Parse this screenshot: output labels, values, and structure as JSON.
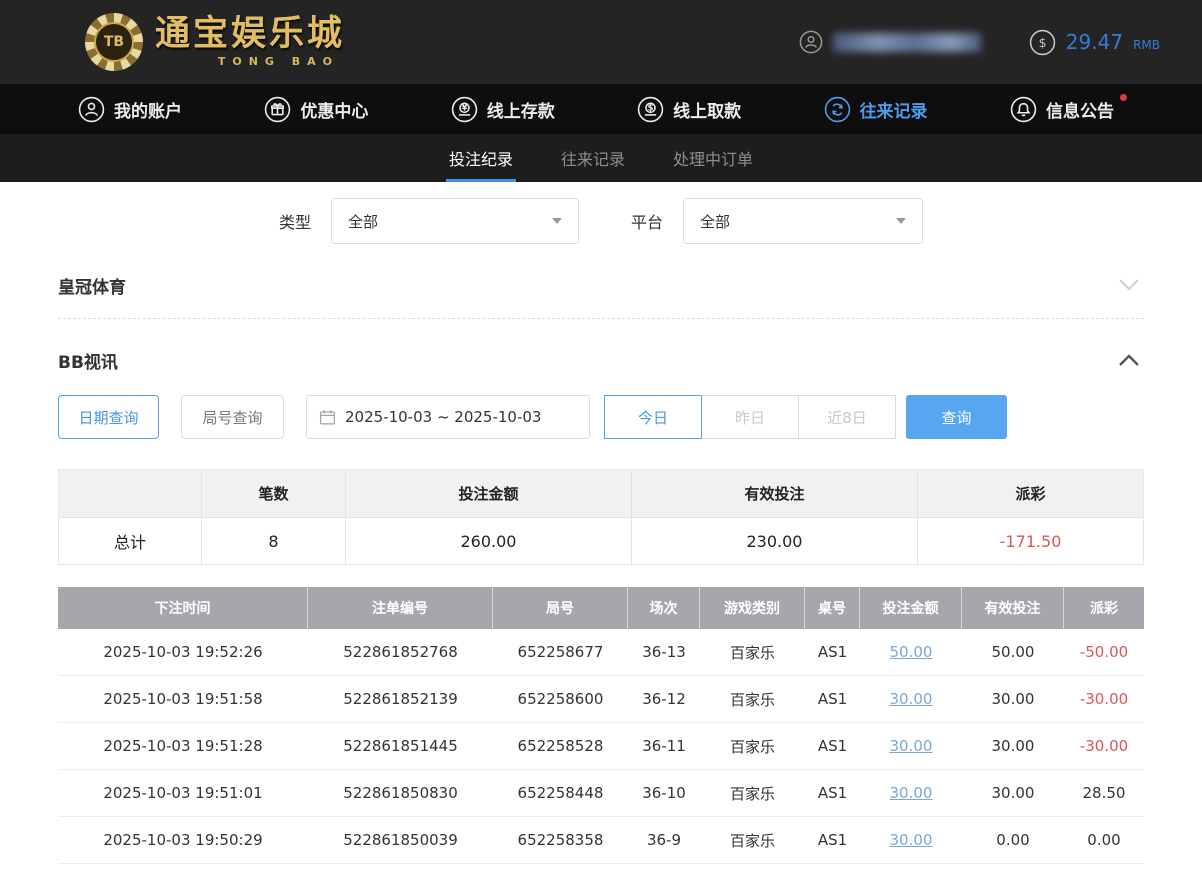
{
  "header": {
    "logo": {
      "chip": "TB",
      "brand": "通宝娱乐城",
      "brand_sub": "TONG BAO"
    },
    "balance": {
      "amount": "29.47",
      "currency": "RMB",
      "icon": "dollar-icon"
    }
  },
  "nav": {
    "items": [
      {
        "label": "我的账户",
        "icon": "user-icon",
        "active": false
      },
      {
        "label": "优惠中心",
        "icon": "gift-icon",
        "active": false
      },
      {
        "label": "线上存款",
        "icon": "deposit-icon",
        "active": false
      },
      {
        "label": "线上取款",
        "icon": "withdraw-icon",
        "active": false
      },
      {
        "label": "往来记录",
        "icon": "records-icon",
        "active": true
      },
      {
        "label": "信息公告",
        "icon": "bell-icon",
        "active": false,
        "badge": true
      }
    ]
  },
  "subnav": {
    "tabs": [
      {
        "label": "投注纪录",
        "active": true
      },
      {
        "label": "往来记录",
        "active": false
      },
      {
        "label": "处理中订单",
        "active": false
      }
    ]
  },
  "filters": {
    "type_label": "类型",
    "type_value": "全部",
    "platform_label": "平台",
    "platform_value": "全部"
  },
  "sections": {
    "crown": "皇冠体育",
    "bb": "BB视讯"
  },
  "query": {
    "date_query": "日期查询",
    "round_query": "局号查询",
    "date_range": "2025-10-03 ~ 2025-10-03",
    "today": "今日",
    "yesterday": "昨日",
    "last8": "近8日",
    "submit": "查询"
  },
  "summary": {
    "col_count": "笔数",
    "col_bet": "投注金额",
    "col_valid": "有效投注",
    "col_payout": "派彩",
    "total_label": "总计",
    "count": "8",
    "bet": "260.00",
    "valid": "230.00",
    "payout": "-171.50"
  },
  "table": {
    "headers": [
      "下注时间",
      "注单编号",
      "局号",
      "场次",
      "游戏类别",
      "桌号",
      "投注金额",
      "有效投注",
      "派彩"
    ],
    "rows": [
      {
        "time": "2025-10-03 19:52:26",
        "bet_id": "522861852768",
        "round": "652258677",
        "session": "36-13",
        "game": "百家乐",
        "table_no": "AS1",
        "bet": "50.00",
        "valid": "50.00",
        "payout": "-50.00"
      },
      {
        "time": "2025-10-03 19:51:58",
        "bet_id": "522861852139",
        "round": "652258600",
        "session": "36-12",
        "game": "百家乐",
        "table_no": "AS1",
        "bet": "30.00",
        "valid": "30.00",
        "payout": "-30.00"
      },
      {
        "time": "2025-10-03 19:51:28",
        "bet_id": "522861851445",
        "round": "652258528",
        "session": "36-11",
        "game": "百家乐",
        "table_no": "AS1",
        "bet": "30.00",
        "valid": "30.00",
        "payout": "-30.00"
      },
      {
        "time": "2025-10-03 19:51:01",
        "bet_id": "522861850830",
        "round": "652258448",
        "session": "36-10",
        "game": "百家乐",
        "table_no": "AS1",
        "bet": "30.00",
        "valid": "30.00",
        "payout": "28.50"
      },
      {
        "time": "2025-10-03 19:50:29",
        "bet_id": "522861850039",
        "round": "652258358",
        "session": "36-9",
        "game": "百家乐",
        "table_no": "AS1",
        "bet": "30.00",
        "valid": "0.00",
        "payout": "0.00"
      }
    ]
  },
  "colors": {
    "accent_blue": "#4a9bef",
    "link_blue": "#7aa6db",
    "negative_red": "#e05555",
    "brand_gold": "#dcb964",
    "table_header_gray": "#a5a7ad"
  }
}
